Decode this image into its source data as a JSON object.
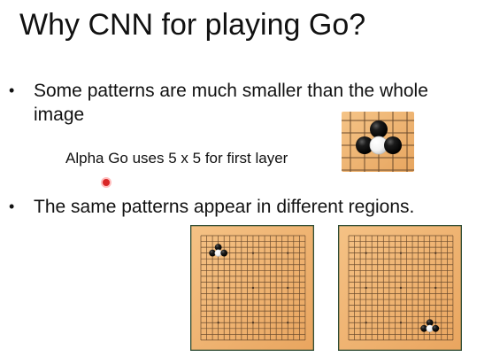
{
  "slide": {
    "title": "Why CNN for playing Go?",
    "bullets": [
      {
        "text": "Some patterns are much smaller than the whole image"
      },
      {
        "text": "The same patterns appear in different regions."
      }
    ],
    "subtext": "Alpha Go uses 5 x 5 for first layer"
  },
  "colors": {
    "text": "#111111",
    "board_fill": "#f0b16f",
    "board_grid": "#6b4b2d",
    "board_frame": "#2f4d35",
    "black_stone": "#111111",
    "white_stone": "#fbfbfb",
    "laser_pointer": "#d92626"
  },
  "icons": {
    "pattern": "go-stone-pattern",
    "left_board": "go-board",
    "right_board": "go-board",
    "pointer": "laser-pointer"
  }
}
